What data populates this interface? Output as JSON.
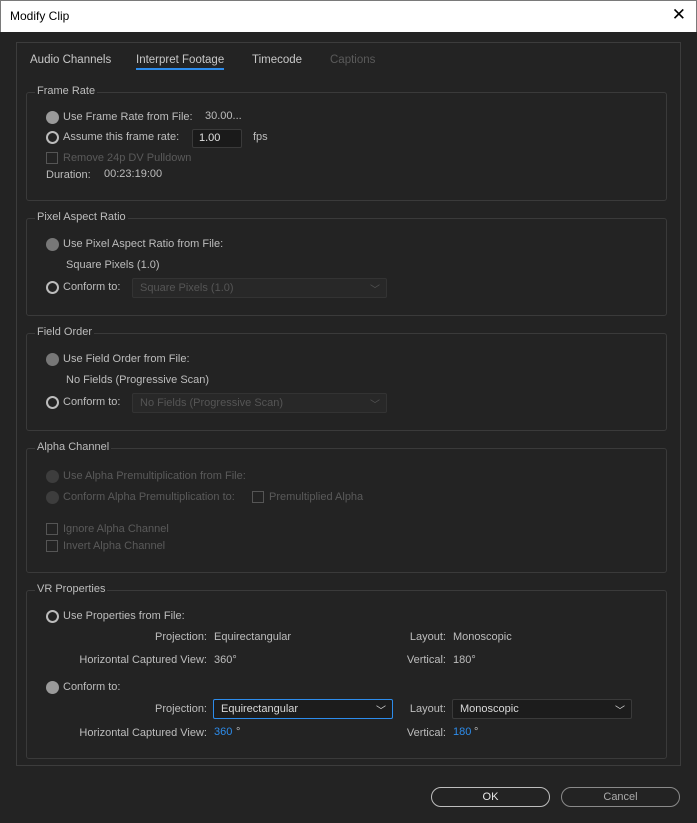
{
  "window": {
    "title": "Modify Clip",
    "close": "✕"
  },
  "tabs": [
    {
      "label": "Audio Channels"
    },
    {
      "label": "Interpret Footage"
    },
    {
      "label": "Timecode"
    },
    {
      "label": "Captions"
    }
  ],
  "frame_rate": {
    "title": "Frame Rate",
    "use_file_label": "Use Frame Rate from File:",
    "file_value": "30.00...",
    "assume_label": "Assume this frame rate:",
    "assume_value": "1.00",
    "fps": "fps",
    "pulldown_label": "Remove 24p DV Pulldown",
    "duration_label": "Duration:",
    "duration_value": "00:23:19:00"
  },
  "pixel_aspect": {
    "title": "Pixel Aspect Ratio",
    "use_file_label": "Use Pixel Aspect Ratio from File:",
    "file_value": "Square Pixels (1.0)",
    "conform_label": "Conform to:",
    "conform_value": "Square Pixels (1.0)"
  },
  "field_order": {
    "title": "Field Order",
    "use_file_label": "Use Field Order from File:",
    "file_value": "No Fields (Progressive Scan)",
    "conform_label": "Conform to:",
    "conform_value": "No Fields (Progressive Scan)"
  },
  "alpha": {
    "title": "Alpha Channel",
    "use_file_label": "Use Alpha Premultiplication from File:",
    "conform_label": "Conform Alpha Premultiplication to:",
    "premult_label": "Premultiplied Alpha",
    "ignore_label": "Ignore Alpha Channel",
    "invert_label": "Invert Alpha Channel"
  },
  "vr": {
    "title": "VR Properties",
    "use_file_label": "Use Properties from File:",
    "projection_label": "Projection:",
    "projection_value": "Equirectangular",
    "layout_label": "Layout:",
    "layout_value": "Monoscopic",
    "hview_label": "Horizontal Captured View:",
    "hview_value": "360°",
    "vertical_label": "Vertical:",
    "vertical_value": "180°",
    "conform_label": "Conform to:",
    "c_projection_value": "Equirectangular",
    "c_layout_value": "Monoscopic",
    "c_hview_value": "360",
    "c_vertical_value": "180",
    "deg": "°"
  },
  "buttons": {
    "ok": "OK",
    "cancel": "Cancel"
  },
  "colors": {
    "accent": "#2d8ceb",
    "bg": "#232323"
  }
}
